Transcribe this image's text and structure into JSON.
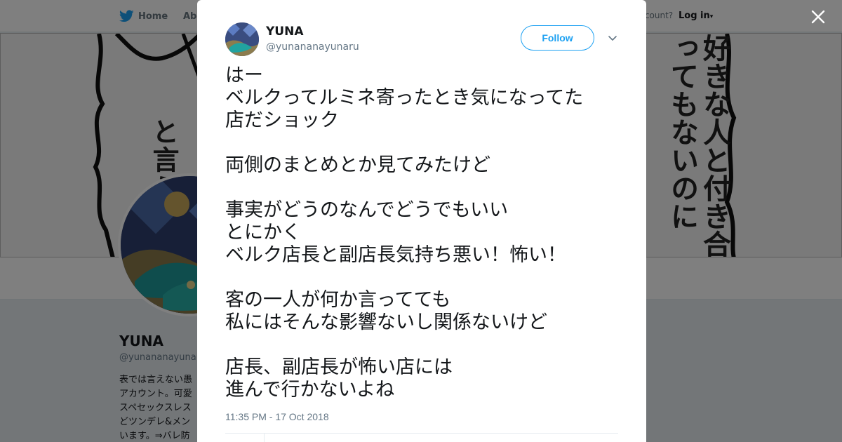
{
  "topbar": {
    "home_label": "Home",
    "about_label": "Abo",
    "account_prompt": "account?",
    "login_label": "Log in",
    "login_caret": "▾"
  },
  "banner": {
    "left_text": "と言う",
    "right_text": "好きな人と付き合ってもないのに"
  },
  "profile": {
    "name": "YUNA",
    "handle": "@yunananayunar",
    "bio": "表では言えない愚\nアカウント。可愛\nスペセックスレス\nどツンデレ&メン\nいます。⇒バレ防"
  },
  "tweet": {
    "name": "YUNA",
    "handle": "@yunananayunaru",
    "follow_label": "Follow",
    "text": "はー\nベルクってルミネ寄ったとき気になってた\n店だショック\n\n両側のまとめとか見てみたけど\n\n事実がどうのなんでどうでもいい\nとにかく\nベルク店長と副店長気持ち悪い！怖い！\n\n客の一人が何か言ってても\n私にはそんな影響ないし関係ないけど\n\n店長、副店長が怖い店には\n進んで行かないよね",
    "timestamp": "11:35 PM - 17 Oct 2018"
  },
  "colors": {
    "accent": "#1da1f2",
    "overlay": "rgba(0,0,0,0.5)",
    "text": "#14171a",
    "muted": "#657786"
  }
}
